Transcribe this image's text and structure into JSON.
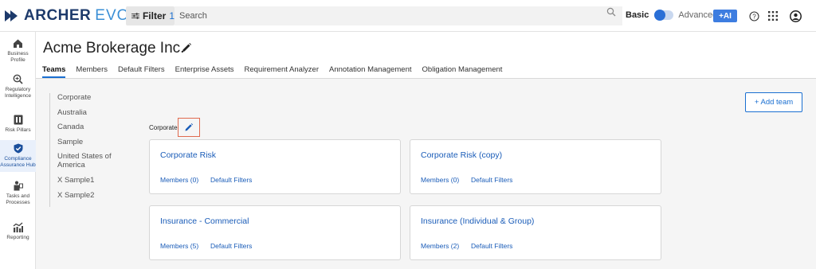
{
  "topbar": {
    "logo_word1": "ARCHER",
    "logo_word2": "EVOLV",
    "filter_label": "Filter",
    "filter_count": "1",
    "search_placeholder": "Search",
    "toggle_left": "Basic",
    "toggle_right": "Advanced",
    "ai_label": "+AI",
    "icons": [
      "search-icon",
      "help-icon",
      "apps-grid-icon",
      "user-account-icon"
    ]
  },
  "rail": {
    "items": [
      {
        "label": "Business Profile",
        "icon": "home-icon"
      },
      {
        "label": "Regulatory Intelligence",
        "icon": "zoom-icon"
      },
      {
        "label": "Risk Pillars",
        "icon": "pillars-icon"
      },
      {
        "label": "Compliance Assurance Hub",
        "icon": "shield-check-icon"
      },
      {
        "label": "Tasks and Processes",
        "icon": "tasks-icon"
      },
      {
        "label": "Reporting",
        "icon": "chart-icon"
      }
    ],
    "active_index": 3
  },
  "header": {
    "title": "Acme Brokerage Inc.",
    "tabs": [
      "Teams",
      "Members",
      "Default Filters",
      "Enterprise Assets",
      "Requirement Analyzer",
      "Annotation Management",
      "Obligation Management"
    ],
    "active_tab": "Teams"
  },
  "teamlist": [
    "Corporate",
    "Australia",
    "Canada",
    "Sample",
    "United States of America",
    "X Sample1",
    "X Sample2"
  ],
  "breadcrumb": "Corporate",
  "add_team_label": "+ Add team",
  "cards": [
    {
      "title": "Corporate Risk",
      "members": "Members (0)",
      "filters": "Default Filters"
    },
    {
      "title": "Corporate Risk (copy)",
      "members": "Members (0)",
      "filters": "Default Filters"
    },
    {
      "title": "Insurance - Commercial",
      "members": "Members (5)",
      "filters": "Default Filters"
    },
    {
      "title": "Insurance (Individual & Group)",
      "members": "Members (2)",
      "filters": "Default Filters"
    }
  ],
  "colors": {
    "accent": "#1a6fd1",
    "highlight_border": "#e06a4f",
    "logo_dark": "#1d3a6b",
    "logo_light": "#3a8fd6"
  }
}
